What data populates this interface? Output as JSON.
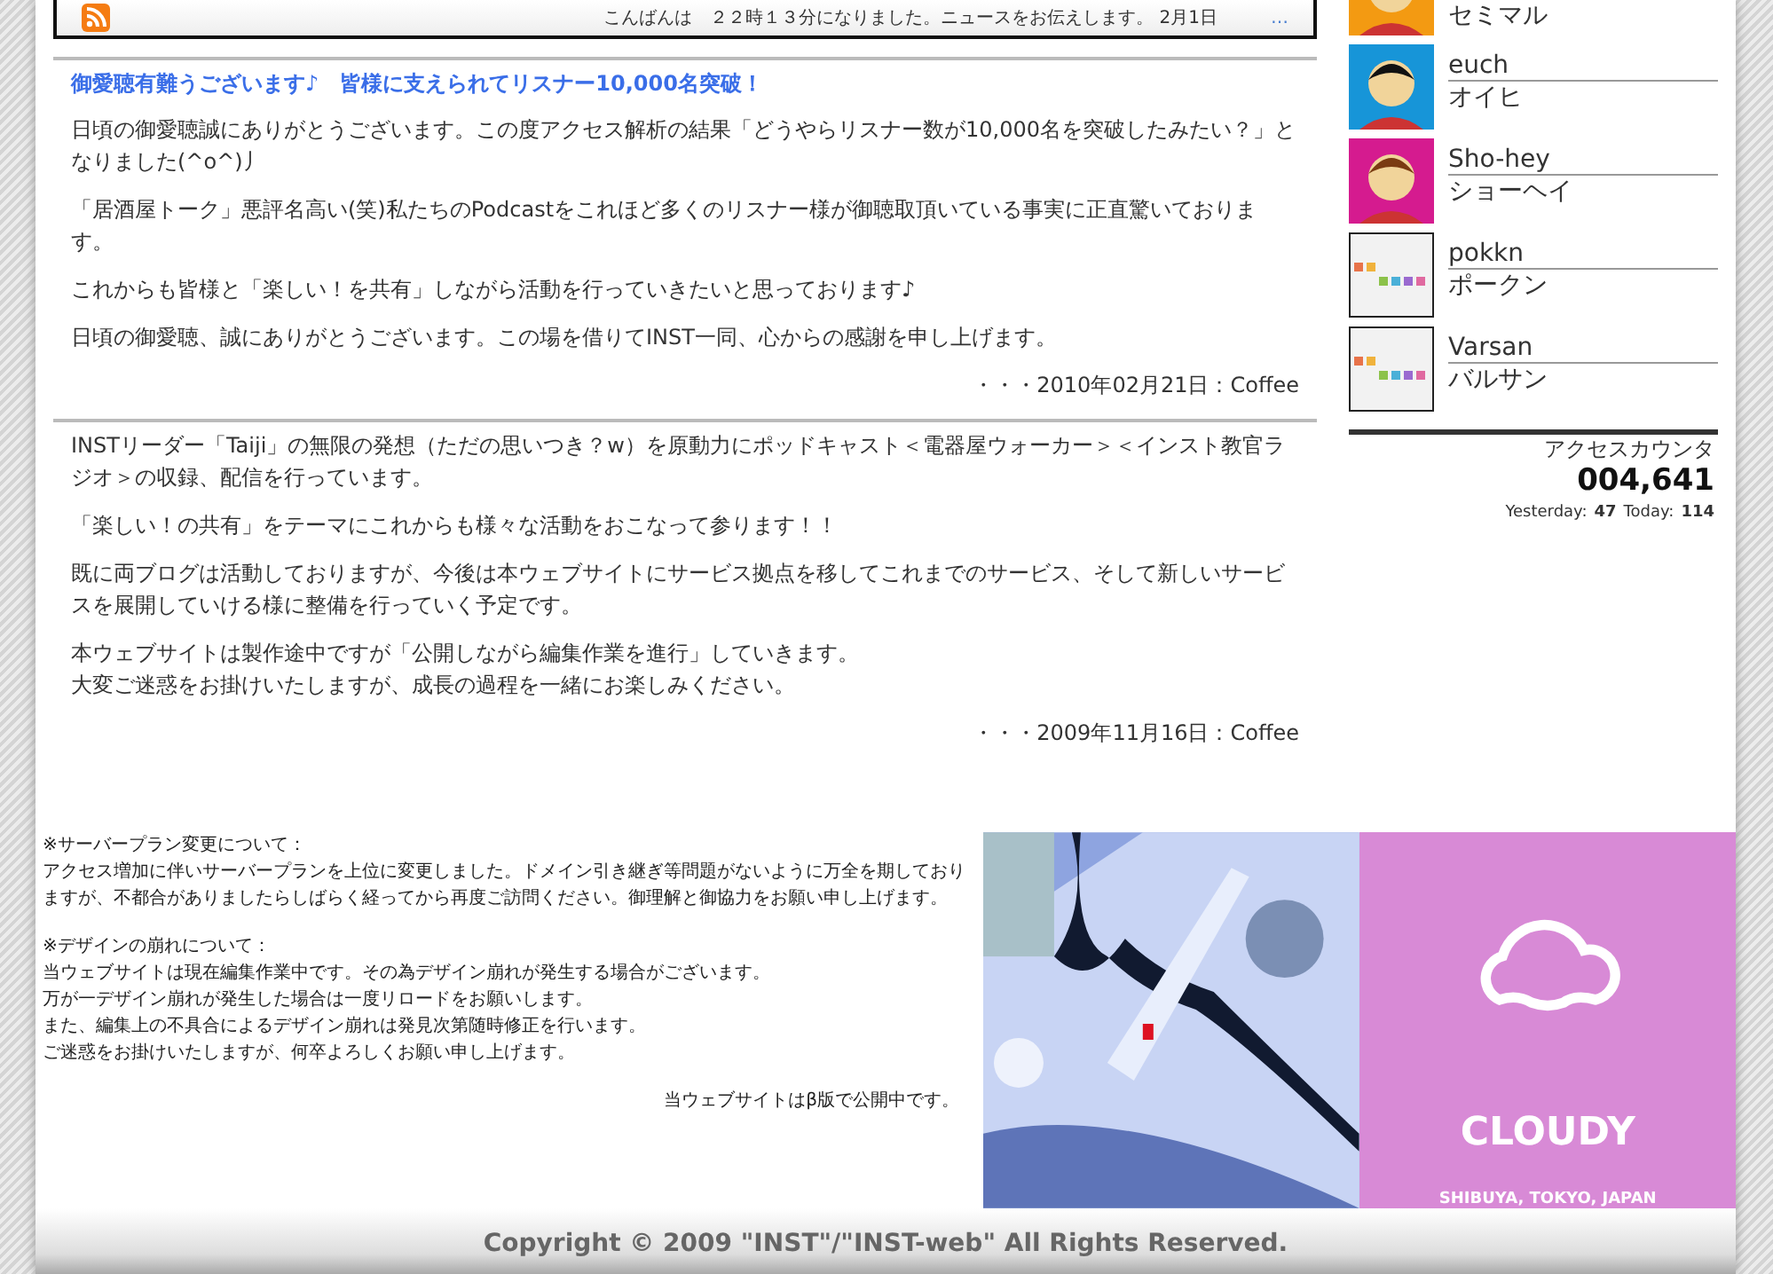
{
  "ticker": {
    "text": "こんばんは　２２時１３分になりました。ニュースをお伝えします。 2月1日",
    "more": "…"
  },
  "posts": [
    {
      "title": "御愛聴有難うございます♪　皆様に支えられてリスナー10,000名突破！",
      "paragraphs": [
        "日頃の御愛聴誠にありがとうございます。この度アクセス解析の結果「どうやらリスナー数が10,000名を突破したみたい？」となりました(^o^)丿",
        "「居酒屋トーク」悪評名高い(笑)私たちのPodcastをこれほど多くのリスナー様が御聴取頂いている事実に正直驚いております。",
        "これからも皆様と「楽しい！を共有」しながら活動を行っていきたいと思っております♪",
        "日頃の御愛聴、誠にありがとうございます。この場を借りてINST一同、心からの感謝を申し上げます。"
      ],
      "signature": "・・・2010年02月21日：Coffee"
    },
    {
      "paragraphs": [
        "INSTリーダー「Taiji」の無限の発想（ただの思いつき？w）を原動力にポッドキャスト＜電器屋ウォーカー＞＜インスト教官ラジオ＞の収録、配信を行っています。",
        "「楽しい！の共有」をテーマにこれからも様々な活動をおこなって参ります！！",
        "既に両ブログは活動しておりますが、今後は本ウェブサイトにサービス拠点を移してこれまでのサービス、そして新しいサービスを展開していける様に整備を行っていく予定です。",
        [
          "本ウェブサイトは製作途中ですが「公開しながら編集作業を進行」していきます。",
          "大変ご迷惑をお掛けいたしますが、成長の過程を一緒にお楽しみください。"
        ]
      ],
      "signature": "・・・2009年11月16日：Coffee"
    }
  ],
  "members": [
    {
      "kind": "avatar",
      "reading": "セミマル"
    },
    {
      "kind": "avatar",
      "name": "euch",
      "reading": "オイヒ"
    },
    {
      "kind": "avatar",
      "name": "Sho-hey",
      "reading": "ショーヘイ"
    },
    {
      "kind": "placeholder",
      "name": "pokkn",
      "reading": "ポークン"
    },
    {
      "kind": "placeholder",
      "name": "Varsan",
      "reading": "バルサン"
    }
  ],
  "counter": {
    "label": "アクセスカウンタ",
    "count": "004,641",
    "yesterday_label": "Yesterday:",
    "yesterday": "47",
    "today_label": "Today:",
    "today": "114"
  },
  "notices": [
    {
      "heading": "※サーバープラン変更について：",
      "lines": [
        "アクセス増加に伴いサーバープランを上位に変更しました。ドメイン引き継ぎ等問題がないように万全を期しておりますが、不都合がありましたらしばらく経ってから再度ご訪問ください。御理解と御協力をお願い申し上げます。"
      ]
    },
    {
      "heading": "※デザインの崩れについて：",
      "lines": [
        "当ウェブサイトは現在編集作業中です。その為デザイン崩れが発生する場合がございます。",
        "万が一デザイン崩れが発生した場合は一度リロードをお願いします。",
        "また、編集上の不具合によるデザイン崩れは発見次第随時修正を行います。",
        "ご迷惑をお掛けいたしますが、何卒よろしくお願い申し上げます。"
      ]
    }
  ],
  "notice_footer": "当ウェブサイトはβ版で公開中です。",
  "weather": {
    "condition": "CLOUDY",
    "location": "SHIBUYA, TOKYO, JAPAN"
  },
  "footer": "Copyright © 2009 \"INST\"/\"INST-web\" All Rights Reserved."
}
